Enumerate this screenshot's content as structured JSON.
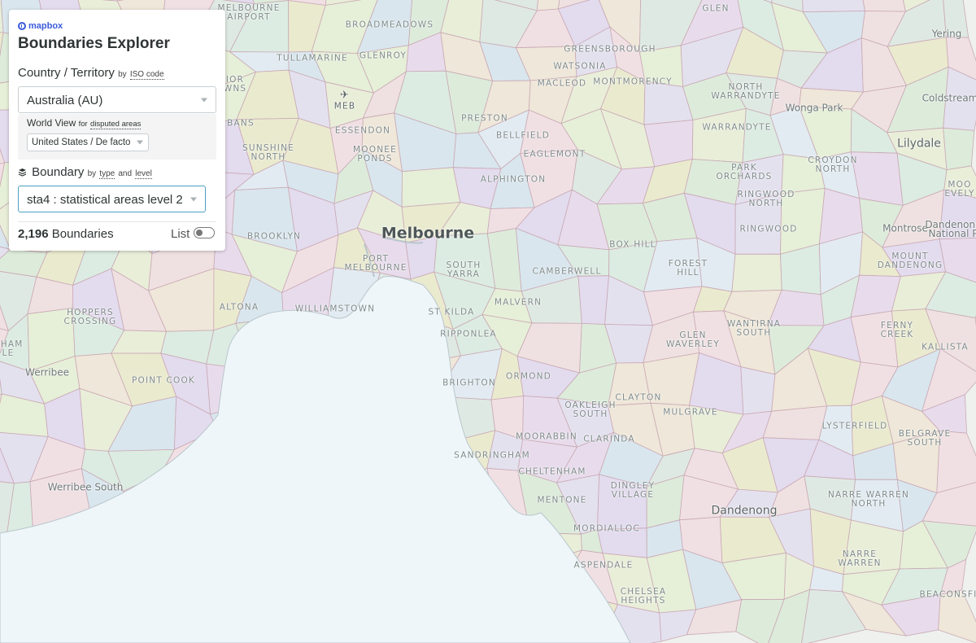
{
  "panel": {
    "brand": "mapbox",
    "title": "Boundaries Explorer",
    "country_label": "Country / Territory",
    "country_hint_by": "by",
    "country_hint_link": "ISO code",
    "country_value": "Australia (AU)",
    "worldview_label": "World View",
    "worldview_hint_for": "for",
    "worldview_hint_link": "disputed areas",
    "worldview_value": "United States / De facto",
    "boundary_label": "Boundary",
    "boundary_hint_by": "by",
    "boundary_hint_type": "type",
    "boundary_hint_and": "and",
    "boundary_hint_level": "level",
    "boundary_value": "sta4 : statistical areas level 2",
    "count_value": "2,196",
    "count_label": "Boundaries",
    "list_label": "List",
    "list_toggle_on": false,
    "accent_color": "#3b5bdb",
    "select_active_border": "#4ea0c6"
  },
  "map": {
    "water_color": "#eef6f9",
    "labels": {
      "broadmeadows": "BROADMEADOWS",
      "melbourne_airport": "MELBOURNE\nAIRPORT",
      "glen": "GLEN",
      "yering": "Yering",
      "greensborough": "GREENSBOROUGH",
      "tullamarine": "TULLAMARINE",
      "glenroy": "GLENROY",
      "watsonia": "WATSONIA",
      "macleod": "MACLEOD",
      "montmorency": "MONTMORENCY",
      "north_warrandyte": "NORTH\nWARRANDYTE",
      "wonga_park": "Wonga Park",
      "coldstream": "Coldstream",
      "meb": "MEB",
      "ior_wns": "IOR\nWNS",
      "preston": "PRESTON",
      "essendon": "ESSENDON",
      "bellfield": "BELLFIELD",
      "bans": "BANS",
      "warrandyte": "WARRANDYTE",
      "lilydale": "Lilydale",
      "sunshine_north": "SUNSHINE\nNORTH",
      "moonee_ponds": "MOONEE\nPONDS",
      "eaglemont": "EAGLEMONT",
      "croydon_north": "CROYDON\nNORTH",
      "park_orchards": "PARK\nORCHARDS",
      "alphington": "ALPHINGTON",
      "ringwood_north": "RINGWOOD\nNORTH",
      "mooroolbark": "MOO\nEVELY",
      "melbourne": "Melbourne",
      "ringwood": "RINGWOOD",
      "montrose": "Montrose",
      "dandenong_ranges": "Dandenong\nNational P",
      "brooklyn": "BROOKLYN",
      "box_hill": "BOX HILL",
      "port_melbourne": "PORT\nMELBOURNE",
      "south_yarra": "SOUTH\nYARRA",
      "camberwell": "CAMBERWELL",
      "forest_hill": "FOREST\nHILL",
      "mount_dandenong": "MOUNT\nDANDENONG",
      "hoppers_crossing": "HOPPERS\nCROSSING",
      "altona": "ALTONA",
      "williamstown": "WILLIAMSTOWN",
      "malvern": "MALVERN",
      "st_kilda": "ST KILDA",
      "wantirna_south": "WANTIRNA\nSOUTH",
      "ferny_creek": "FERNY\nCREEK",
      "ripponlea": "RIPPONLEA",
      "glen_waverley": "GLEN\nWAVERLEY",
      "kallista": "KALLISTA",
      "dham_le": "DHAM\nLE",
      "werribee": "Werribee",
      "ormond": "ORMOND",
      "point_cook": "POINT COOK",
      "brighton": "BRIGHTON",
      "clayton": "CLAYTON",
      "oakleigh_south": "OAKLEIGH\nSOUTH",
      "mulgrave": "MULGRAVE",
      "lysterfield": "LYSTERFIELD",
      "moorabbin": "MOORABBIN",
      "clarinda": "CLARINDA",
      "belgrave_south": "BELGRAVE\nSOUTH",
      "sandringham": "SANDRINGHAM",
      "cheltenham": "CHELTENHAM",
      "werribee_south": "Werribee South",
      "dingley_village": "DINGLEY\nVILLAGE",
      "mentone": "MENTONE",
      "narre_warren_north": "NARRE WARREN\nNORTH",
      "dandenong": "Dandenong",
      "mordialloc": "MORDIALLOC",
      "narre_warren": "NARRE\nWARREN",
      "aspendale": "ASPENDALE",
      "chelsea_heights": "CHELSEA\nHEIGHTS",
      "beaconsfield": "BEACONSFI"
    }
  }
}
